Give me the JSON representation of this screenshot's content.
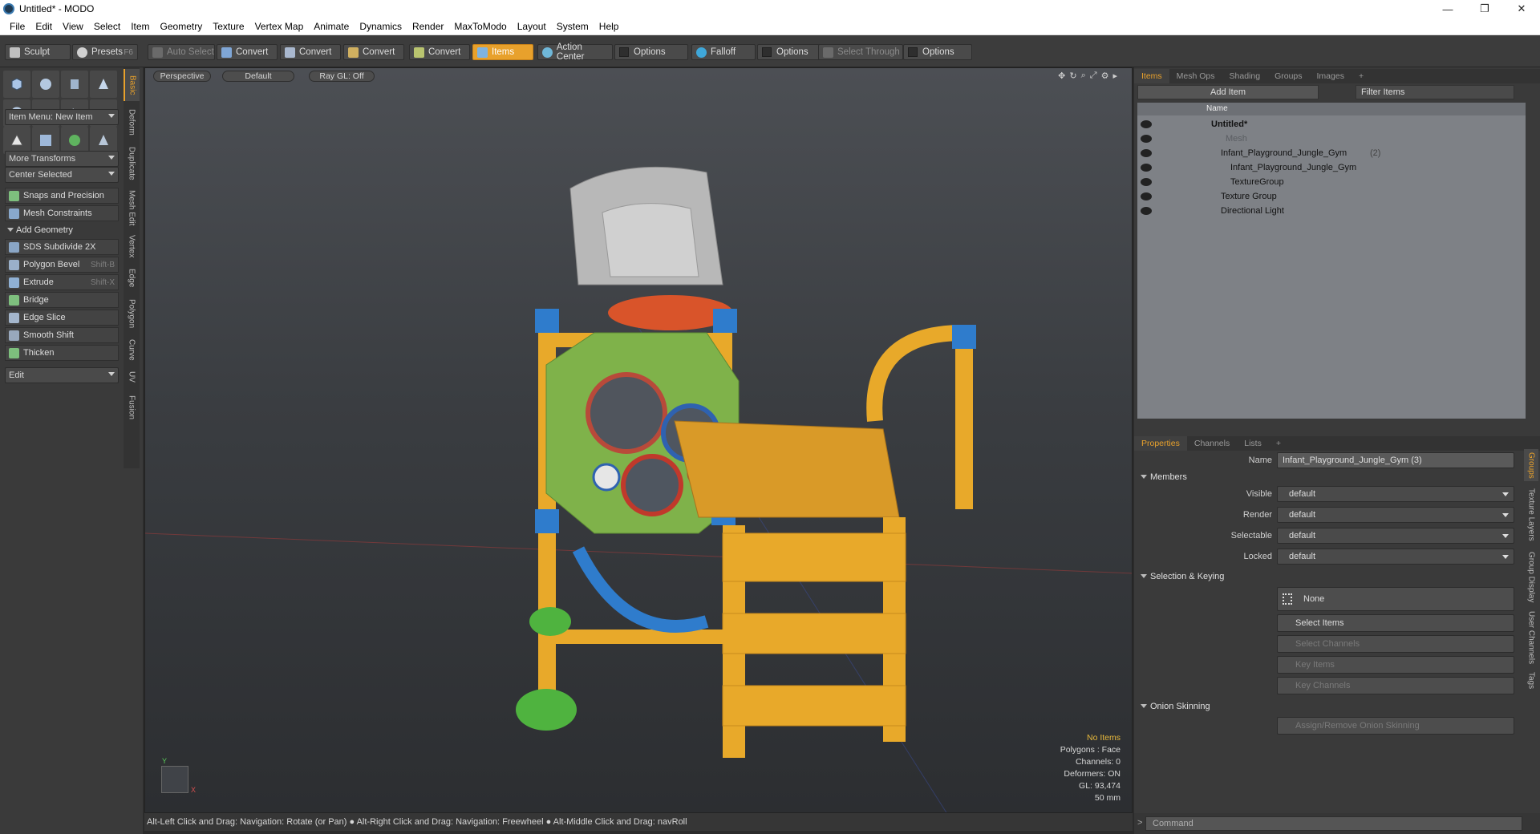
{
  "window": {
    "title": "Untitled* - MODO",
    "controls": [
      "—",
      "❐",
      "✕"
    ]
  },
  "menu": [
    "File",
    "Edit",
    "View",
    "Select",
    "Item",
    "Geometry",
    "Texture",
    "Vertex Map",
    "Animate",
    "Dynamics",
    "Render",
    "MaxToModo",
    "Layout",
    "System",
    "Help"
  ],
  "toolbar": {
    "sculpt": "Sculpt",
    "presets": "Presets",
    "presets_shortcut": "F6",
    "auto_select": "Auto Select",
    "convert1": "Convert",
    "convert2": "Convert",
    "convert3": "Convert",
    "convert4": "Convert",
    "items": "Items",
    "action_center": "Action Center",
    "options1": "Options",
    "falloff": "Falloff",
    "options2": "Options",
    "select_through": "Select Through",
    "options3": "Options"
  },
  "left": {
    "item_menu": "Item Menu: New Item",
    "more_transforms": "More Transforms",
    "center_selected": "Center Selected",
    "snaps": "Snaps and Precision",
    "mesh_constraints": "Mesh Constraints",
    "add_geometry": "Add Geometry",
    "tools": [
      {
        "label": "SDS Subdivide 2X",
        "shortcut": ""
      },
      {
        "label": "Polygon Bevel",
        "shortcut": "Shift-B"
      },
      {
        "label": "Extrude",
        "shortcut": "Shift-X"
      },
      {
        "label": "Bridge",
        "shortcut": ""
      },
      {
        "label": "Edge Slice",
        "shortcut": ""
      },
      {
        "label": "Smooth Shift",
        "shortcut": ""
      },
      {
        "label": "Thicken",
        "shortcut": ""
      }
    ],
    "edit": "Edit",
    "vtabs": [
      "Basic",
      "Deform",
      "Duplicate",
      "Mesh Edit",
      "Vertex",
      "Edge",
      "Polygon",
      "Curve",
      "UV",
      "Fusion"
    ]
  },
  "viewport": {
    "perspective": "Perspective",
    "default": "Default",
    "raygl": "Ray GL: Off",
    "info": {
      "no_items": "No Items",
      "polygons": "Polygons : Face",
      "channels": "Channels: 0",
      "deformers": "Deformers: ON",
      "gl": "GL: 93,474",
      "mm": "50 mm"
    },
    "axis_y": "Y",
    "axis_x": "X"
  },
  "status": "Alt-Left Click and Drag: Navigation: Rotate (or Pan) ● Alt-Right Click and Drag: Navigation: Freewheel ● Alt-Middle Click and Drag: navRoll",
  "right": {
    "tabs": [
      "Items",
      "Mesh Ops",
      "Shading",
      "Groups",
      "Images"
    ],
    "add_item": "Add Item",
    "filter_items": "Filter Items",
    "col_name": "Name",
    "tree": [
      {
        "label": "Untitled*",
        "indent": 0
      },
      {
        "label": "Mesh",
        "indent": 1
      },
      {
        "label": "Infant_Playground_Jungle_Gym",
        "count": "(2)",
        "indent": 1
      },
      {
        "label": "Infant_Playground_Jungle_Gym",
        "indent": 2
      },
      {
        "label": "TextureGroup",
        "indent": 2
      },
      {
        "label": "Texture Group",
        "indent": 1
      },
      {
        "label": "Directional Light",
        "indent": 1
      }
    ],
    "prop_tabs": [
      "Properties",
      "Channels",
      "Lists"
    ],
    "name_label": "Name",
    "name_value": "Infant_Playground_Jungle_Gym (3)",
    "members": "Members",
    "visible_label": "Visible",
    "visible": "default",
    "render_label": "Render",
    "render": "default",
    "selectable_label": "Selectable",
    "selectable": "default",
    "locked_label": "Locked",
    "locked": "default",
    "sel_keying": "Selection & Keying",
    "none": "None",
    "select_items": "Select Items",
    "select_channels": "Select Channels",
    "key_items": "Key Items",
    "key_channels": "Key Channels",
    "onion": "Onion Skinning",
    "assign_onion": "Assign/Remove Onion Skinning",
    "rvtabs": [
      "Groups",
      "Texture Layers",
      "Group Display",
      "User Channels",
      "Tags"
    ],
    "command": "Command"
  }
}
